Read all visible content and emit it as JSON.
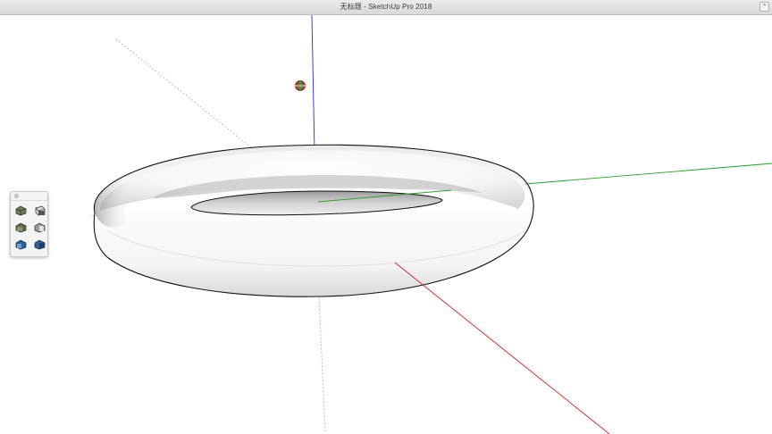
{
  "window": {
    "title": "无标题 - SketchUp Pro 2018",
    "fullscreen_glyph": "⌃"
  },
  "axes": {
    "red_color": "#c4232b",
    "green_color": "#2a9a2a",
    "blue_color": "#2b2bd6"
  },
  "model": {
    "shape": "torus",
    "fill_color": "#ffffff",
    "edge_color": "#111111"
  },
  "cursor": {
    "icon": "orbit-cursor-icon"
  },
  "palette": {
    "name": "views-toolbar",
    "tools": [
      {
        "name": "iso-view-button",
        "icon": "iso-view-icon"
      },
      {
        "name": "top-view-button",
        "icon": "top-view-icon"
      },
      {
        "name": "front-view-button",
        "icon": "front-view-icon"
      },
      {
        "name": "right-view-button",
        "icon": "right-view-icon"
      },
      {
        "name": "back-view-button",
        "icon": "back-view-icon"
      },
      {
        "name": "left-view-button",
        "icon": "left-view-icon"
      }
    ]
  }
}
